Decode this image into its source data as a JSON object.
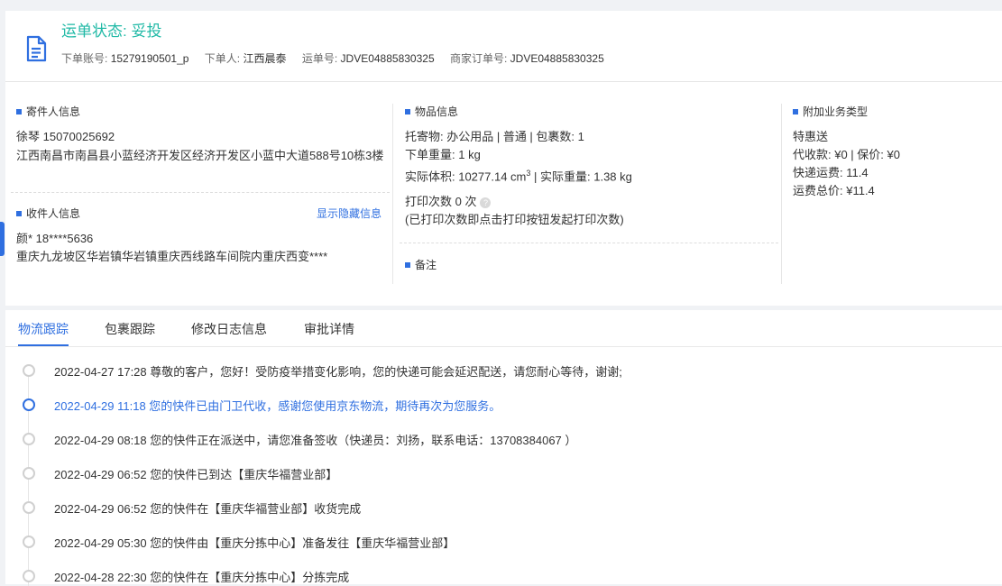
{
  "header": {
    "status": "运单状态: 妥投",
    "order_account_label": "下单账号:",
    "order_account_value": "15279190501_p",
    "placer_label": "下单人:",
    "placer_value": "江西晨泰",
    "waybill_label": "运单号:",
    "waybill_value": "JDVE04885830325",
    "merchant_order_label": "商家订单号:",
    "merchant_order_value": "JDVE04885830325"
  },
  "sender": {
    "title": "寄件人信息",
    "name_phone": "徐琴   15070025692",
    "address": "江西南昌市南昌县小蓝经济开发区经济开发区小蓝中大道588号10栋3楼"
  },
  "receiver": {
    "title": "收件人信息",
    "show_hidden": "显示隐藏信息",
    "name_phone": "颜*   18****5636",
    "address": "重庆九龙坡区华岩镇华岩镇重庆西线路车间院内重庆西变****"
  },
  "goods": {
    "title": "物品信息",
    "line1": "托寄物:  办公用品 | 普通  |  包裹数:  1",
    "line2": "下单重量:   1 kg",
    "line3_a": "实际体积:    10277.14 cm",
    "line3_sup": "3",
    "line3_b": " |  实际重量:   1.38 kg",
    "print_count": "打印次数    0 次",
    "print_note": "(已打印次数即点击打印按钮发起打印次数)"
  },
  "remark": {
    "title": "备注"
  },
  "extra": {
    "title": "附加业务类型",
    "service": "特惠送",
    "cod": "代收款:   ¥0  |  保价:   ¥0",
    "express_fee": "快递运费:   11.4",
    "total_fee": "运费总价:   ¥11.4"
  },
  "tabs": {
    "t1": "物流跟踪",
    "t2": "包裹跟踪",
    "t3": "修改日志信息",
    "t4": "审批详情"
  },
  "timeline": [
    {
      "text": "2022-04-27 17:28 尊敬的客户，您好！受防疫举措变化影响，您的快递可能会延迟配送，请您耐心等待，谢谢;"
    },
    {
      "text": "2022-04-29 11:18 您的快件已由门卫代收，感谢您使用京东物流，期待再次为您服务。"
    },
    {
      "text": "2022-04-29 08:18 您的快件正在派送中，请您准备签收（快递员：刘扬，联系电话：13708384067 ）"
    },
    {
      "text": "2022-04-29 06:52 您的快件已到达【重庆华福营业部】"
    },
    {
      "text": "2022-04-29 06:52 您的快件在【重庆华福营业部】收货完成"
    },
    {
      "text": "2022-04-29 05:30 您的快件由【重庆分拣中心】准备发往【重庆华福营业部】"
    },
    {
      "text": "2022-04-28 22:30 您的快件在【重庆分拣中心】分拣完成"
    }
  ],
  "colors": {
    "status": "#20b9a6",
    "accent": "#2f6fe0"
  }
}
